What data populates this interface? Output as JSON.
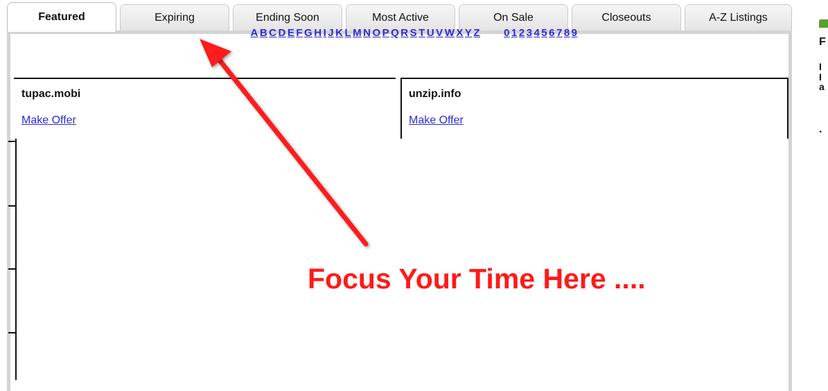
{
  "tabs": [
    {
      "label": "Featured",
      "active": true
    },
    {
      "label": "Expiring",
      "active": false
    },
    {
      "label": "Ending Soon",
      "active": false
    },
    {
      "label": "Most Active",
      "active": false
    },
    {
      "label": "On Sale",
      "active": false
    },
    {
      "label": "Closeouts",
      "active": false
    },
    {
      "label": "A-Z Listings",
      "active": false
    }
  ],
  "alphabet": {
    "letters": [
      "A",
      "B",
      "C",
      "D",
      "E",
      "F",
      "G",
      "H",
      "I",
      "J",
      "K",
      "L",
      "M",
      "N",
      "O",
      "P",
      "Q",
      "R",
      "S",
      "T",
      "U",
      "V",
      "W",
      "X",
      "Y",
      "Z"
    ],
    "digits": [
      "0",
      "1",
      "2",
      "3",
      "4",
      "5",
      "6",
      "7",
      "8",
      "9"
    ]
  },
  "listings": [
    {
      "name": "tupac.mobi",
      "action": "Make Offer"
    },
    {
      "name": "unzip.info",
      "action": "Make Offer"
    }
  ],
  "annotation": {
    "text": "Focus Your Time Here ....",
    "color": "#ff1a1a"
  },
  "sidebar": {
    "header_color": "#5ca02a",
    "chars": [
      "F",
      "I",
      "I",
      "a",
      "."
    ]
  },
  "colors": {
    "link": "#2b2bd9",
    "tab_border": "#c8c8c8",
    "frame": "#d3d3d3"
  }
}
